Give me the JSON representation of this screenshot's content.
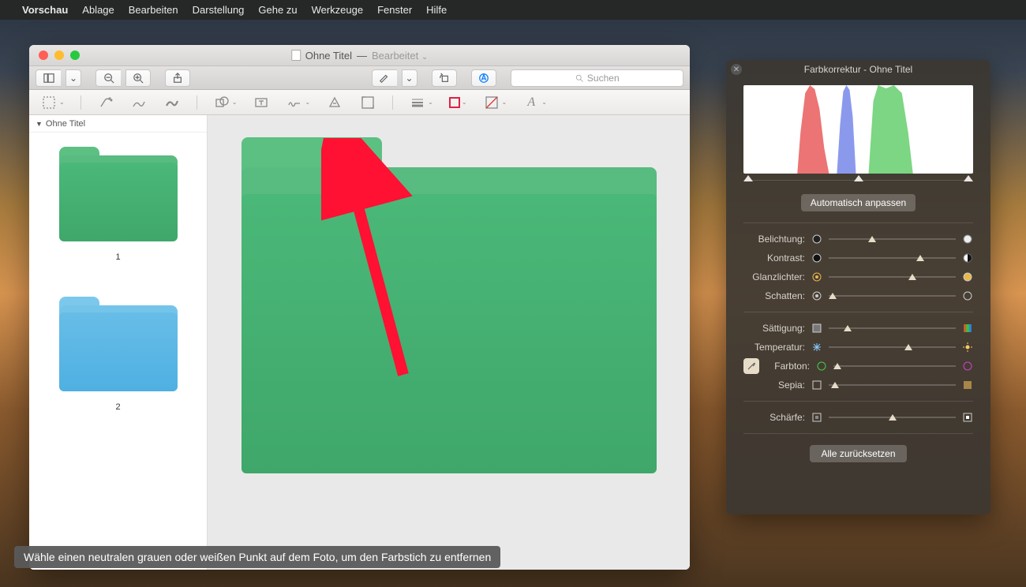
{
  "menubar": {
    "app": "Vorschau",
    "items": [
      "Ablage",
      "Bearbeiten",
      "Darstellung",
      "Gehe zu",
      "Werkzeuge",
      "Fenster",
      "Hilfe"
    ]
  },
  "window": {
    "title": "Ohne Titel",
    "status": "Bearbeitet",
    "search_placeholder": "Suchen",
    "sidebar_title": "Ohne Titel",
    "thumb1_label": "1",
    "thumb2_label": "2"
  },
  "panel": {
    "title": "Farbkorrektur - Ohne Titel",
    "auto": "Automatisch anpassen",
    "reset": "Alle zurücksetzen",
    "sliders": {
      "exposure": {
        "label": "Belichtung:",
        "pos": 0.34
      },
      "contrast": {
        "label": "Kontrast:",
        "pos": 0.72
      },
      "highlights": {
        "label": "Glanzlichter:",
        "pos": 0.66
      },
      "shadows": {
        "label": "Schatten:",
        "pos": 0.03
      },
      "saturation": {
        "label": "Sättigung:",
        "pos": 0.15
      },
      "temperature": {
        "label": "Temperatur:",
        "pos": 0.63
      },
      "tint": {
        "label": "Farbton:",
        "pos": 0.03
      },
      "sepia": {
        "label": "Sepia:",
        "pos": 0.05
      },
      "sharpness": {
        "label": "Schärfe:",
        "pos": 0.5
      }
    },
    "histogram_handles": [
      0.0,
      0.5,
      1.0
    ]
  },
  "tooltip": "Wähle einen neutralen grauen oder weißen Punkt auf dem Foto, um den Farbstich zu entfernen"
}
